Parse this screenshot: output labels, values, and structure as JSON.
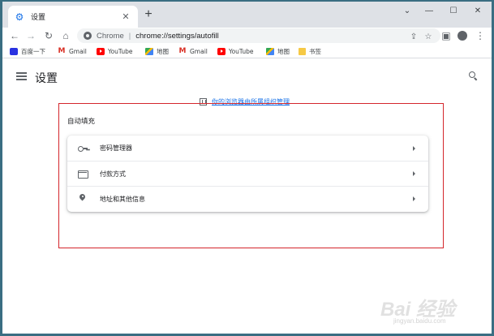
{
  "tab": {
    "title": "设置",
    "close": "✕",
    "new_tab": "+"
  },
  "window_controls": {
    "minimize": "—",
    "maximize": "☐",
    "close": "✕",
    "dropdown": "⌄"
  },
  "toolbar": {
    "back": "←",
    "forward": "→",
    "reload": "↻",
    "home": "⌂",
    "share": "⇪",
    "star": "☆",
    "sidepanel": "▣",
    "menu": "⋮"
  },
  "omnibox": {
    "scheme_label": "Chrome",
    "separator": "|",
    "url": "chrome://settings/autofill"
  },
  "bookmarks": [
    {
      "label": "百度一下",
      "icon": "baidu-icon"
    },
    {
      "label": "Gmail",
      "icon": "gmail-icon"
    },
    {
      "label": "YouTube",
      "icon": "youtube-icon"
    },
    {
      "label": "地图",
      "icon": "maps-icon"
    },
    {
      "label": "Gmail",
      "icon": "gmail-icon"
    },
    {
      "label": "YouTube",
      "icon": "youtube-icon"
    },
    {
      "label": "地图",
      "icon": "maps-icon"
    },
    {
      "label": "书签",
      "icon": "folder-icon"
    }
  ],
  "settings": {
    "title": "设置",
    "managed_notice": "你的浏览器由所属组织管理",
    "section_title": "自动填充",
    "rows": [
      {
        "label": "密码管理器",
        "icon": "key-icon"
      },
      {
        "label": "付款方式",
        "icon": "credit-card-icon"
      },
      {
        "label": "地址和其他信息",
        "icon": "location-pin-icon"
      }
    ]
  },
  "watermark": {
    "text": "Bai 经验",
    "sub": "jingyan.baidu.com"
  },
  "colors": {
    "highlight_border": "#d4262c",
    "accent": "#1a73e8",
    "tabstrip": "#dee1e6"
  }
}
